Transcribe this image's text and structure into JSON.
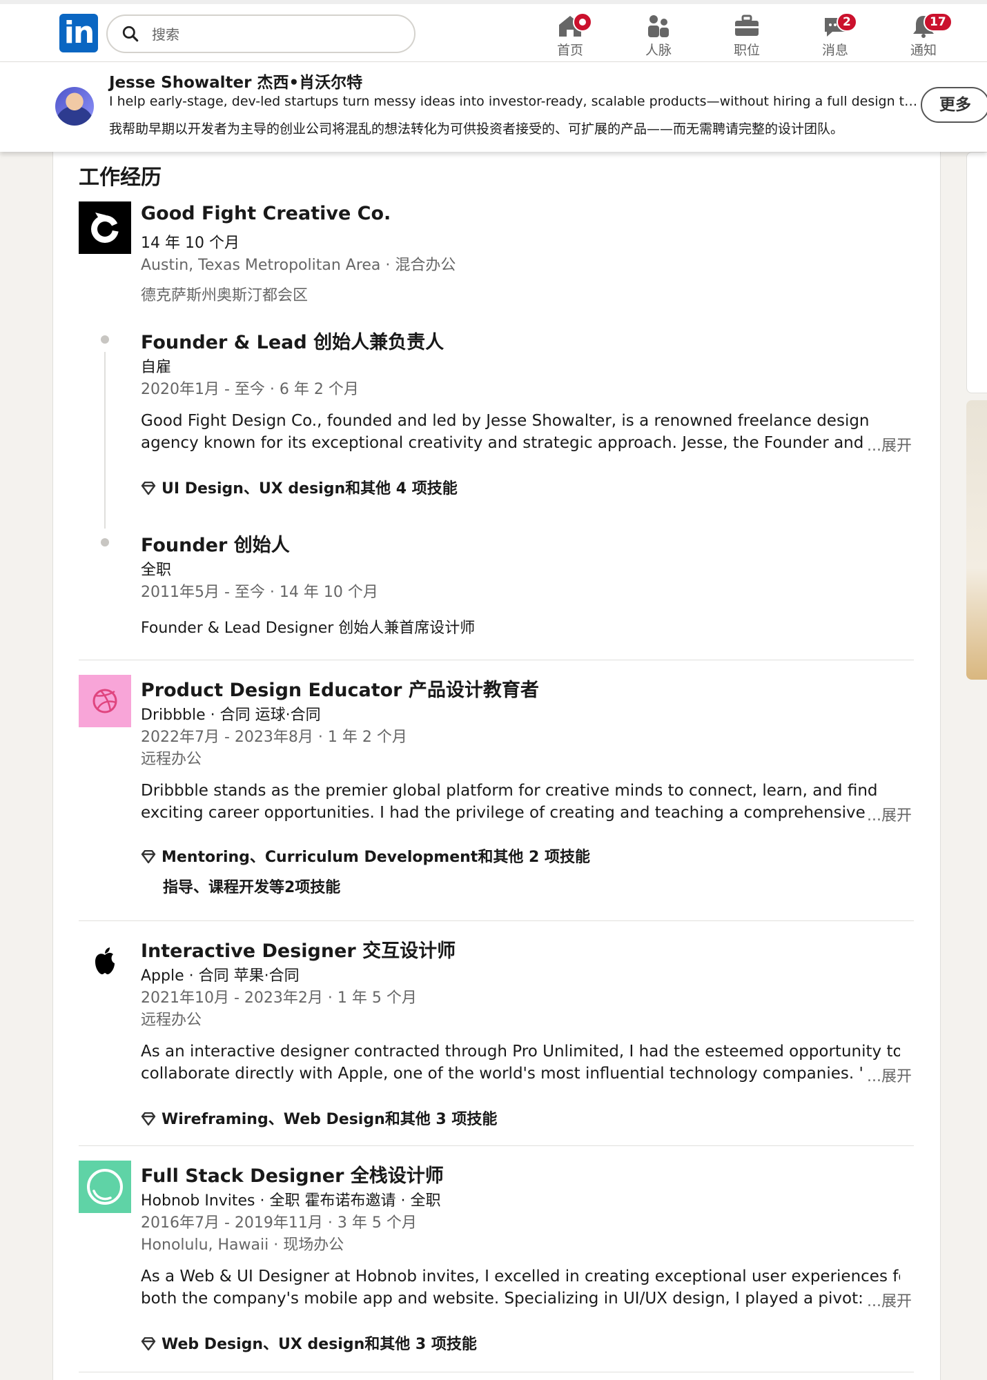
{
  "nav": {
    "logo": "in",
    "search_placeholder": "搜索",
    "items": [
      {
        "label": "首页",
        "badge": ""
      },
      {
        "label": "人脉",
        "badge": ""
      },
      {
        "label": "职位",
        "badge": ""
      },
      {
        "label": "消息",
        "badge": "2"
      },
      {
        "label": "通知",
        "badge": "17"
      }
    ]
  },
  "profile_bar": {
    "name": "Jesse Showalter  杰西•肖沃尔特",
    "headline": "I help early-stage, dev-led startups turn messy ideas into investor-ready, scalable products—without hiring a full design team.",
    "headline_zh": "我帮助早期以开发者为主导的创业公司将混乱的想法转化为可供投资者接受的、可扩展的产品——而无需聘请完整的设计团队。",
    "more_button": "更多"
  },
  "experience": {
    "section_title": "工作经历",
    "expand_label": "...展开",
    "good_fight": {
      "company": "Good Fight Creative Co.",
      "duration": "14 年 10 个月",
      "location": "Austin, Texas Metropolitan Area · 混合办公",
      "location_zh": "德克萨斯州奥斯汀都会区",
      "roles": [
        {
          "title": "Founder & Lead  创始人兼负责人",
          "type": "自雇",
          "dates": "2020年1月 - 至今 · 6 年 2 个月",
          "desc_line1": "Good Fight Design Co., founded and led by Jesse Showalter, is a renowned freelance design",
          "desc_line2": "agency known for its exceptional creativity and strategic approach. Jesse, the Founder and",
          "skills": "UI Design、UX design和其他 4 项技能"
        },
        {
          "title": "Founder  创始人",
          "type": "全职",
          "dates": "2011年5月 - 至今 · 14 年 10 个月",
          "desc": "Founder & Lead Designer  创始人兼首席设计师"
        }
      ]
    },
    "dribbble": {
      "title": "Product Design Educator  产品设计教育者",
      "company_line": "Dribbble · 合同  运球·合同",
      "dates": "2022年7月 - 2023年8月 · 1 年 2 个月",
      "work_mode": "远程办公",
      "desc_line1": "Dribbble stands as the premier global platform for creative minds to connect, learn, and find",
      "desc_line2": "exciting career opportunities. I had the privilege of creating and teaching a comprehensive",
      "skills": "Mentoring、Curriculum Development和其他 2 项技能",
      "skills_zh": "指导、课程开发等2项技能"
    },
    "apple": {
      "title": "Interactive Designer  交互设计师",
      "company_line": "Apple · 合同  苹果·合同",
      "dates": "2021年10月 - 2023年2月 · 1 年 5 个月",
      "work_mode": "远程办公",
      "desc_line1": "As an interactive designer contracted through Pro Unlimited, I had the esteemed opportunity to",
      "desc_line2": "collaborate directly with Apple, one of the world's most influential technology companies. '",
      "skills": "Wireframing、Web Design和其他 3 项技能"
    },
    "hobnob": {
      "title": "Full Stack Designer  全栈设计师",
      "company_line": "Hobnob Invites · 全职  霍布诺布邀请 · 全职",
      "dates": "2016年7月 - 2019年11月 · 3 年 5 个月",
      "location": "Honolulu, Hawaii · 现场办公",
      "desc_line1": "As a Web & UI Designer at Hobnob invites, I excelled in creating exceptional user experiences for",
      "desc_line2": "both the company's mobile app and website. Specializing in UI/UX design, I played a pivot:",
      "skills": "Web Design、UX design和其他 3 项技能"
    }
  },
  "colors": {
    "linkedin_blue": "#0a66c2",
    "badge_red": "#cb112d",
    "dribbble_pink": "#f8a5d8",
    "hobnob_green": "#5fd3a6"
  }
}
